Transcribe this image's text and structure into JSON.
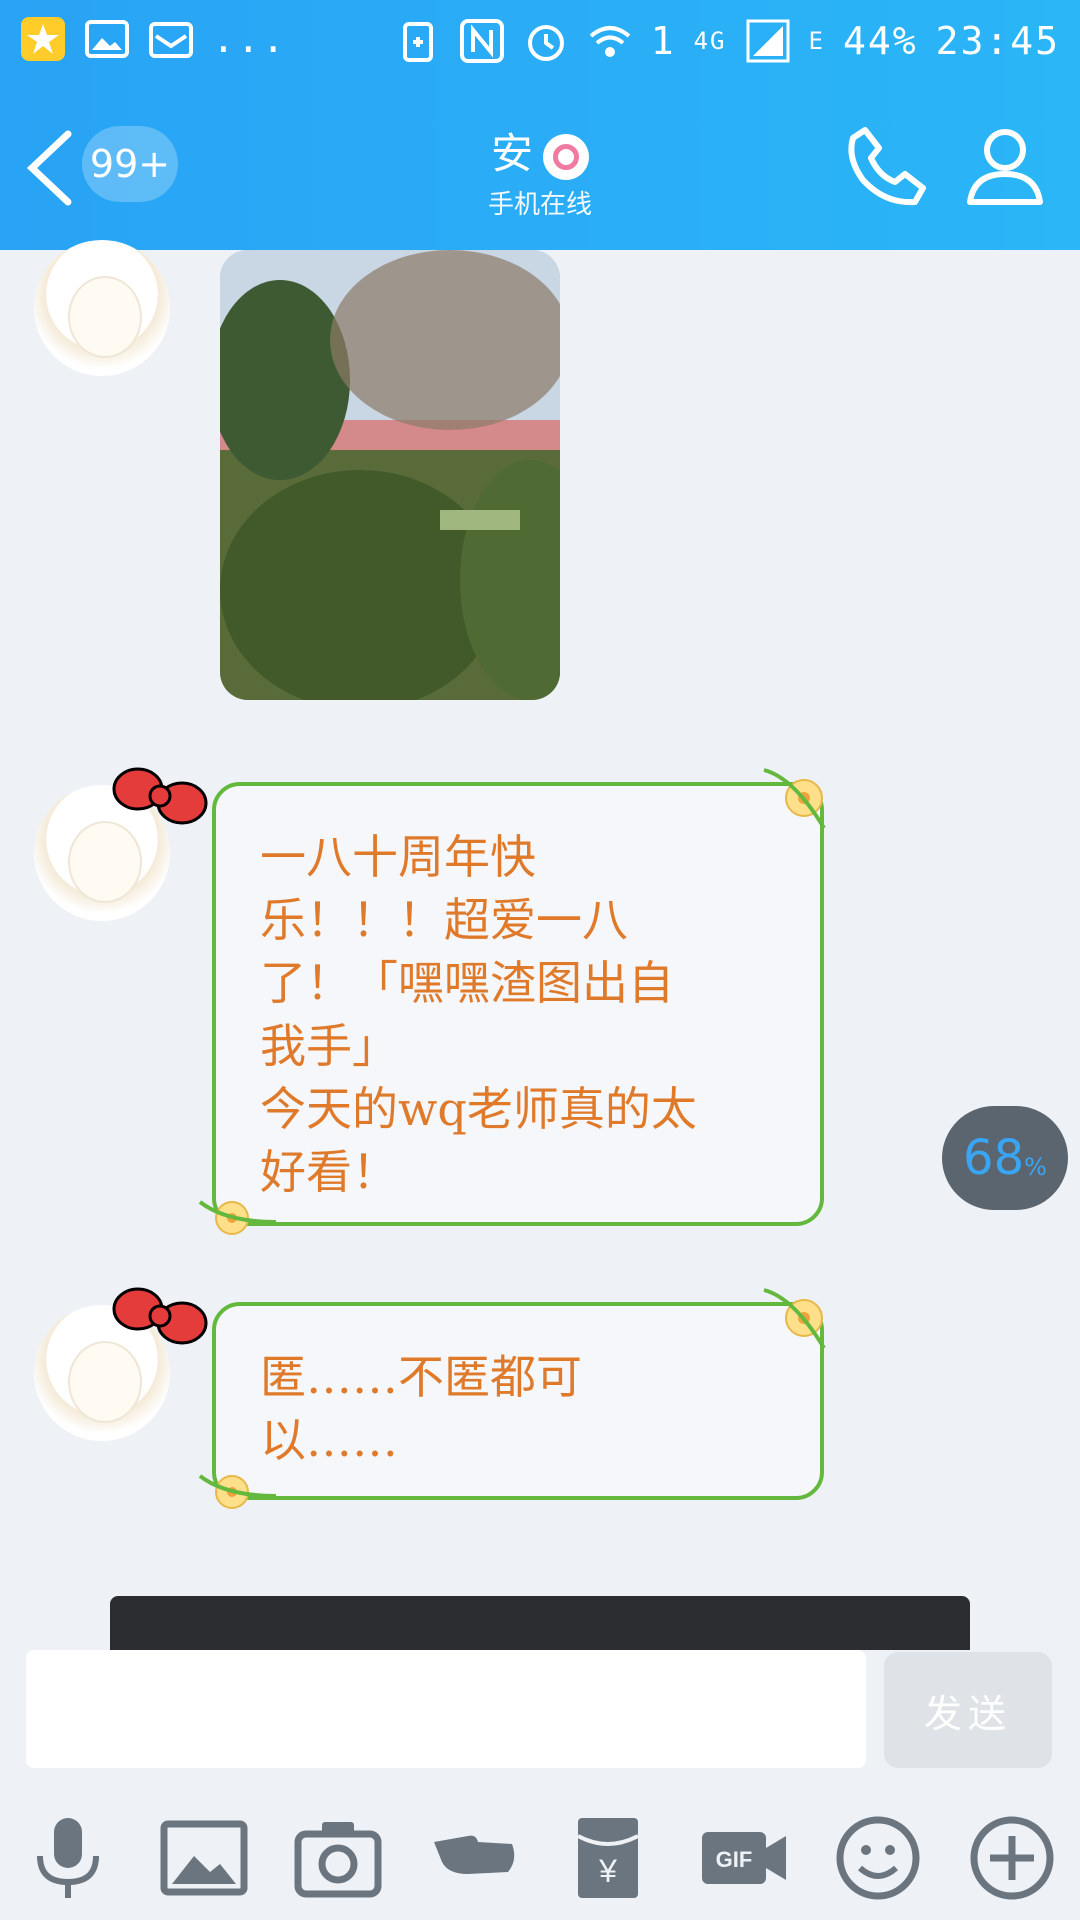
{
  "status_bar": {
    "left_icons": [
      "qzone-icon",
      "gallery-icon",
      "mail-icon"
    ],
    "more": "...",
    "right_icons": [
      "battery-saver-icon",
      "nfc-icon",
      "alarm-icon",
      "wifi-icon"
    ],
    "sim_slot": "1",
    "network_4g": "4G",
    "network_e": "E",
    "battery": "44%",
    "time": "23:45"
  },
  "header": {
    "back_badge": "99+",
    "contact_name": "安",
    "contact_status": "手机在线",
    "colors": {
      "primary": "#29a3f5"
    }
  },
  "messages": [
    {
      "type": "image",
      "description_icon": "photo-thumbnail"
    },
    {
      "type": "text",
      "text": "一八十周年快\n乐！！！超爱一八\n了！「嘿嘿渣图出自\n我手」\n今天的wq老师真的太\n好看！"
    },
    {
      "type": "text",
      "text": "匿……不匿都可\n以……"
    }
  ],
  "upload_progress": {
    "value": "68",
    "unit": "%"
  },
  "composer": {
    "placeholder": "",
    "value": "",
    "send_label": "发送"
  },
  "toolbar": {
    "icons": [
      "microphone-icon",
      "image-icon",
      "camera-icon",
      "poke-icon",
      "red-packet-icon",
      "gif-icon",
      "emoji-icon",
      "plus-icon"
    ]
  }
}
